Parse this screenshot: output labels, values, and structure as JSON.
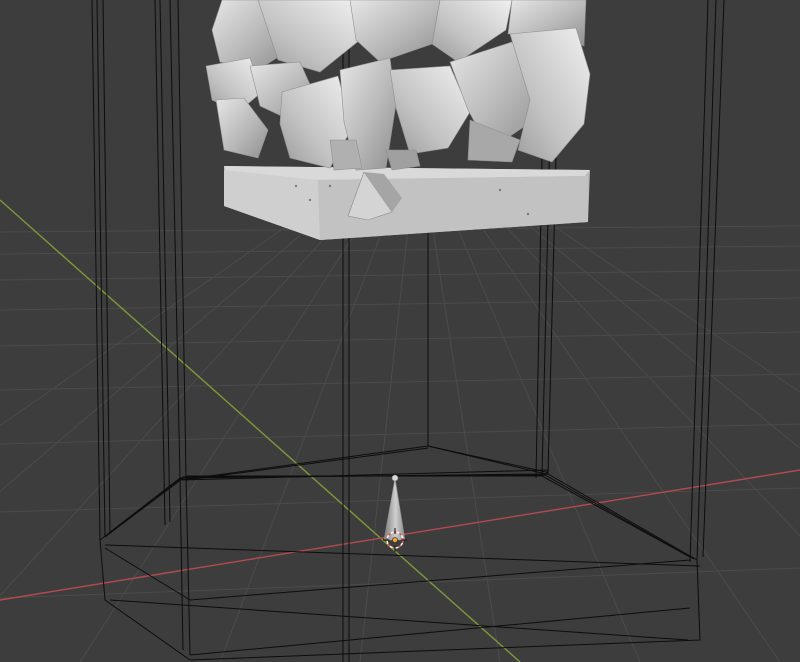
{
  "viewport": {
    "background": "#3d3d3d",
    "grid_color": "#4a4a4a",
    "axis_x_color": "#b34a52",
    "axis_y_color": "#7c9a3a",
    "wireframe_color": "#000000",
    "mesh_color": "#bdbdbd",
    "selected_object_color": "#f2a33a"
  },
  "icons": {
    "cursor": "3d-cursor-icon",
    "origin": "object-origin-icon"
  }
}
